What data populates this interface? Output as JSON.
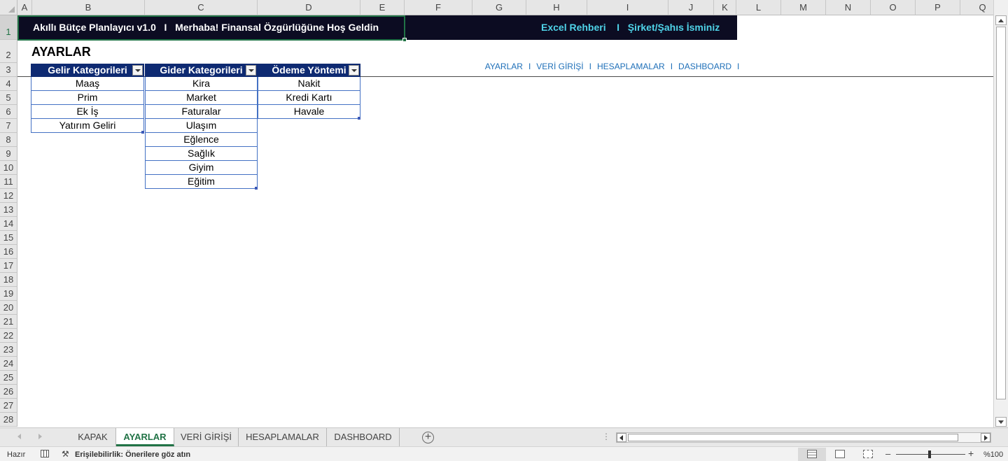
{
  "columns": [
    "A",
    "B",
    "C",
    "D",
    "E",
    "F",
    "G",
    "H",
    "I",
    "J",
    "K",
    "L",
    "M",
    "N",
    "O",
    "P",
    "Q"
  ],
  "rows": [
    "1",
    "2",
    "3",
    "4",
    "5",
    "6",
    "7",
    "8",
    "9",
    "10",
    "11",
    "12",
    "13",
    "14",
    "15",
    "16",
    "17",
    "18",
    "19",
    "20",
    "21",
    "22",
    "23",
    "24",
    "25",
    "26",
    "27",
    "28"
  ],
  "banner": {
    "left_text": "Akıllı Bütçe Planlayıcı v1.0   I   Merhaba! Finansal Özgürlüğüne Hoş Geldin",
    "right_text": "Excel Rehberi    I   Şirket/Şahıs İsminiz"
  },
  "page_heading": "AYARLAR",
  "nav_links": [
    "AYARLAR",
    "VERİ GİRİŞİ",
    "HESAPLAMALAR",
    "DASHBOARD"
  ],
  "nav_separator": "I",
  "tables": {
    "income": {
      "header": "Gelir Kategorileri",
      "items": [
        "Maaş",
        "Prim",
        "Ek İş",
        "Yatırım Geliri"
      ]
    },
    "expense": {
      "header": "Gider Kategorileri",
      "items": [
        "Kira",
        "Market",
        "Faturalar",
        "Ulaşım",
        "Eğlence",
        "Sağlık",
        "Giyim",
        "Eğitim"
      ]
    },
    "payment": {
      "header": "Ödeme Yöntemi",
      "items": [
        "Nakit",
        "Kredi Kartı",
        "Havale"
      ]
    }
  },
  "sheet_tabs": [
    "KAPAK",
    "AYARLAR",
    "VERİ GİRİŞİ",
    "HESAPLAMALAR",
    "DASHBOARD"
  ],
  "active_tab": "AYARLAR",
  "status": {
    "ready": "Hazır",
    "accessibility": "Erişilebilirlik: Önerilere göz atın",
    "zoom": "%100"
  },
  "colors": {
    "banner_bg": "#0c0c22",
    "banner_accent": "#4fd3e8",
    "table_header": "#0e2a72",
    "table_border": "#4471c4",
    "nav_link": "#1e6fb8",
    "excel_green": "#217346"
  },
  "icons": {
    "filter": "dropdown-filter-icon",
    "add_sheet": "plus-circle-icon",
    "accessibility": "accessibility-check-icon"
  }
}
